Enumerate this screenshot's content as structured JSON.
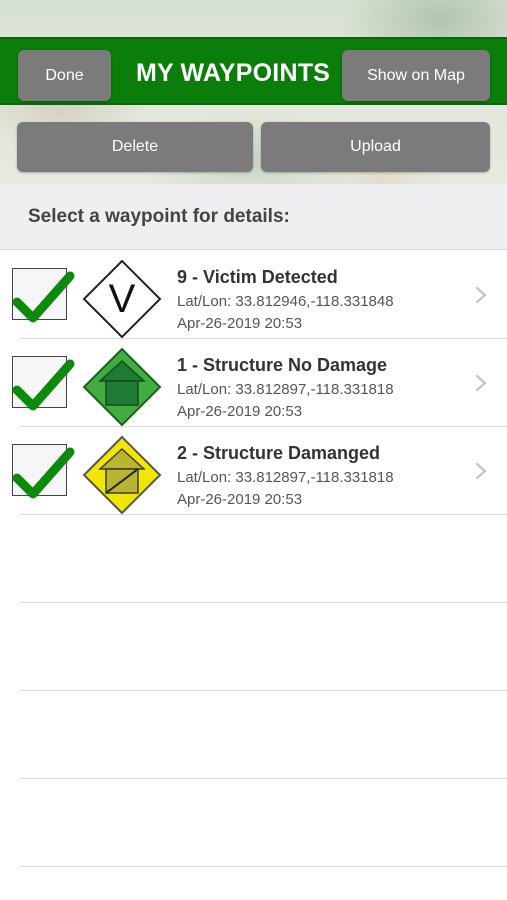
{
  "header": {
    "title": "MY WAYPOINTS",
    "done_label": "Done",
    "show_map_label": "Show on Map",
    "bar_color": "#0a7d0a"
  },
  "actions": {
    "delete_label": "Delete",
    "upload_label": "Upload"
  },
  "section": {
    "title": "Select a waypoint for details:"
  },
  "waypoints": [
    {
      "title": "9 - Victim Detected",
      "latlon": "Lat/Lon: 33.812946,-118.331848",
      "datetime": "Apr-26-2019 20:53",
      "icon": "victim-detected-icon",
      "checked": true
    },
    {
      "title": "1 - Structure No Damage",
      "latlon": "Lat/Lon: 33.812897,-118.331818",
      "datetime": "Apr-26-2019 20:53",
      "icon": "structure-no-damage-icon",
      "checked": true
    },
    {
      "title": "2 - Structure Damanged",
      "latlon": "Lat/Lon: 33.812897,-118.331818",
      "datetime": "Apr-26-2019 20:53",
      "icon": "structure-damaged-icon",
      "checked": true
    }
  ],
  "icon_letter": "V",
  "colors": {
    "check": "#0c8a0c",
    "no_damage_fill": "#3fae3f",
    "damaged_fill": "#f2e600"
  }
}
